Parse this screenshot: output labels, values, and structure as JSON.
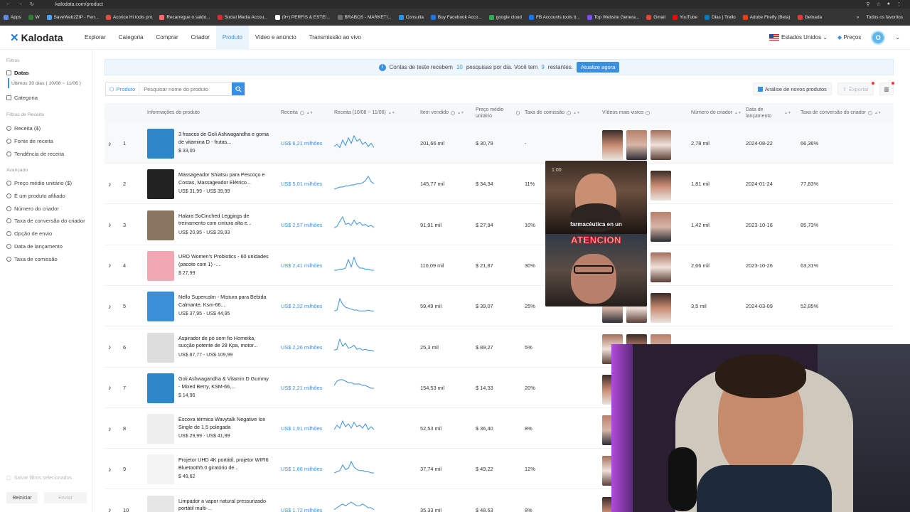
{
  "browser": {
    "url": "kalodata.com/product",
    "bookmarks": [
      "Apps",
      "W",
      "SaveWeb2ZIP - Ferr...",
      "Acorice Hi tools pro",
      "Recarregue o saldo...",
      "Social Media Accou...",
      "(9+) PERFIS & ESTEI...",
      "BRABOS - MARKETI...",
      "Consulta",
      "Buy Facebook Acco...",
      "google cloud",
      "FB Accounts tools b...",
      "Top Website Genera...",
      "Gmail",
      "YouTube",
      "Dias | Trello",
      "Adobe Firefly (Beta)",
      "Getnada"
    ],
    "bookmarks_end": "Todos os favoritos"
  },
  "header": {
    "logo": "Kalodata",
    "nav": [
      "Explorar",
      "Categoria",
      "Comprar",
      "Criador",
      "Produto",
      "Vídeo e anúncio",
      "Transmissão ao vivo"
    ],
    "active_nav": "Produto",
    "region": "Estados Unidos",
    "pricing": "Preços",
    "avatar_letter": "O"
  },
  "sidebar": {
    "filters_title": "Filtros",
    "dates_label": "Datas",
    "dates_value": "Últimos 30 dias ( 10/08 ~ 11/06 )",
    "category": "Categoria",
    "revenue_section": "Filtros de Receita",
    "revenue_items": [
      "Receita ($)",
      "Fonte de receita",
      "Tendência de receita"
    ],
    "advanced_section": "Avançado",
    "advanced_items": [
      "Preço médio unitário ($)",
      "É um produto afiliado",
      "Número do criador",
      "Taxa de conversão do criador",
      "Opção de envio",
      "Data de lançamento",
      "Taxa de comissão"
    ],
    "save_filters": "Salvar filtros selecionados",
    "reset": "Reiniciar",
    "submit": "Enviar"
  },
  "notice": {
    "pre": "Contas de teste recebem",
    "count": "10",
    "mid": "pesquisas por dia. Você tem",
    "remaining": "9",
    "post": "restantes.",
    "button": "Atualize agora"
  },
  "toolbar": {
    "product_tag": "Produto",
    "search_placeholder": "Pesquisar nome do produto",
    "new_products": "Análise de novos produtos",
    "export": "Exportar"
  },
  "table": {
    "headers": {
      "info": "Informações do produto",
      "revenue": "Receita",
      "revenue_trend": "Receita (10/08 ~ 11/06)",
      "items_sold": "Item vendido",
      "avg_price": "Preço médio unitário",
      "commission": "Taxa de comissão",
      "top_videos": "Vídeos mais vistos",
      "creators": "Número do criador",
      "launch_date": "Data de lançamento",
      "conversion": "Taxa de conversão do criador"
    },
    "rows": [
      {
        "rank": "1",
        "name": "3 frascos de Goli Ashwagandha e goma de vitamina D - frutas...",
        "price": "$ 33,00",
        "revenue": "US$ 6,21 milhões",
        "sold": "201,66 mil",
        "avg": "$ 30,79",
        "commission": "-",
        "creators": "2,78 mil",
        "date": "2024-08-22",
        "conv": "66,36%",
        "trend": [
          6,
          8,
          5,
          12,
          7,
          14,
          9,
          16,
          11,
          13,
          8,
          10,
          6,
          9,
          5
        ],
        "img": "#2f86c9"
      },
      {
        "rank": "2",
        "name": "Massageador Shiatsu para Pescoço e Costas, Massageador Elétrico...",
        "price": "US$ 31,99 - US$ 39,99",
        "revenue": "US$ 5,01 milhões",
        "sold": "145,77 mil",
        "avg": "$ 34,34",
        "commission": "11%",
        "creators": "1,81 mil",
        "date": "2024-01-24",
        "conv": "77,83%",
        "trend": [
          4,
          5,
          6,
          6,
          7,
          7,
          8,
          8,
          9,
          9,
          10,
          12,
          16,
          11,
          9
        ],
        "img": "#222222"
      },
      {
        "rank": "3",
        "name": "Halara SoCinched Leggings de treinamento com cintura alta e...",
        "price": "US$ 20,95 - US$ 29,93",
        "revenue": "US$ 2,57 milhões",
        "sold": "91,91 mil",
        "avg": "$ 27,94",
        "commission": "10%",
        "creators": "1,42 mil",
        "date": "2023-10-16",
        "conv": "85,73%",
        "trend": [
          6,
          7,
          12,
          16,
          9,
          10,
          8,
          13,
          9,
          11,
          8,
          9,
          7,
          8,
          6
        ],
        "img": "#8a7560"
      },
      {
        "rank": "4",
        "name": "URO Women's Probiotics - 60 unidades (pacote com 1) -...",
        "price": "$ 27,99",
        "revenue": "US$ 2,41 milhões",
        "sold": "110,09 mil",
        "avg": "$ 21,87",
        "commission": "30%",
        "creators": "2,66 mil",
        "date": "2023-10-26",
        "conv": "63,31%",
        "trend": [
          4,
          4,
          5,
          5,
          6,
          14,
          7,
          16,
          9,
          6,
          6,
          5,
          5,
          4,
          4
        ],
        "img": "#f2a7b5"
      },
      {
        "rank": "5",
        "name": "Nello Supercalm - Mistura para Bebida Calmante, Ksm-66...",
        "price": "US$ 37,95 - US$ 44,95",
        "revenue": "US$ 2,32 milhões",
        "sold": "59,49 mil",
        "avg": "$ 39,07",
        "commission": "25%",
        "creators": "3,5 mil",
        "date": "2024-03-09",
        "conv": "52,85%",
        "trend": [
          5,
          6,
          18,
          12,
          9,
          8,
          7,
          6,
          6,
          5,
          5,
          5,
          6,
          5,
          5
        ],
        "img": "#3b8fd8"
      },
      {
        "rank": "6",
        "name": "Aspirador de pó sem fio Homeika, sucção potente de 28 Kpa, motor...",
        "price": "US$ 87,77 - US$ 109,99",
        "revenue": "US$ 2,26 milhões",
        "sold": "25,3 mil",
        "avg": "$ 89,27",
        "commission": "5%",
        "creators": "",
        "date": "",
        "conv": "",
        "trend": [
          6,
          7,
          17,
          10,
          13,
          8,
          9,
          11,
          7,
          8,
          6,
          7,
          6,
          6,
          5
        ],
        "img": "#dddddd"
      },
      {
        "rank": "7",
        "name": "Goli Ashwagandha & Vitamin D Gummy - Mixed Berry, KSM-66,...",
        "price": "$ 14,96",
        "revenue": "US$ 2,21 milhões",
        "sold": "154,53 mil",
        "avg": "$ 14,33",
        "commission": "20%",
        "creators": "",
        "date": "",
        "conv": "",
        "trend": [
          8,
          11,
          12,
          12,
          11,
          10,
          10,
          9,
          9,
          9,
          8,
          8,
          7,
          6,
          6
        ],
        "img": "#2f86c9"
      },
      {
        "rank": "8",
        "name": "Escova térmica Wavytalk Negative Ion Single de 1,5 polegada",
        "price": "US$ 29,99 - US$ 41,99",
        "revenue": "US$ 1,91 milhões",
        "sold": "52,53 mil",
        "avg": "$ 36,40",
        "commission": "8%",
        "creators": "",
        "date": "",
        "conv": "",
        "trend": [
          6,
          9,
          7,
          12,
          8,
          10,
          7,
          11,
          8,
          9,
          7,
          10,
          6,
          8,
          6
        ],
        "img": "#eeeeee"
      },
      {
        "rank": "9",
        "name": "Projetor UHD 4K portátil, projetor WIFI6 Bluetooth5.0 giratório de...",
        "price": "$ 49,62",
        "revenue": "US$ 1,86 milhões",
        "sold": "37,74 mil",
        "avg": "$ 49,22",
        "commission": "12%",
        "creators": "",
        "date": "",
        "conv": "",
        "trend": [
          5,
          6,
          7,
          12,
          8,
          9,
          15,
          10,
          8,
          7,
          7,
          6,
          6,
          5,
          5
        ],
        "img": "#f4f4f4"
      },
      {
        "rank": "10",
        "name": "Limpador a vapor natural pressurizado portátil multi-...",
        "price": "",
        "revenue": "US$ 1,72 milhões",
        "sold": "35,33 mil",
        "avg": "$ 48,63",
        "commission": "8%",
        "creators": "",
        "date": "",
        "conv": "",
        "trend": [
          5,
          6,
          7,
          8,
          7,
          8,
          9,
          8,
          7,
          7,
          8,
          7,
          6,
          6,
          5
        ],
        "img": "#e6e6e6"
      }
    ]
  },
  "popup": {
    "time": "1:00",
    "caption1": "farmacéutica en un",
    "caption2": "ATENCION"
  }
}
